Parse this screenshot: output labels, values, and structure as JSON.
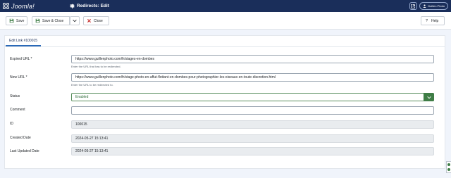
{
  "header": {
    "logo_text": "Joomla!",
    "page_title": "Redirects: Edit",
    "user_button": "Guillen Photo"
  },
  "toolbar": {
    "save_label": "Save",
    "save_close_label": "Save & Close",
    "close_label": "Close",
    "help_label": "Help"
  },
  "tab": {
    "label": "Edit Link #100015"
  },
  "form": {
    "expired_url": {
      "label": "Expired URL *",
      "value": "https://www.guillenphoto.com/fr/stages-en-dombes",
      "hint": "Enter the URL that has to be redirected."
    },
    "new_url": {
      "label": "New URL *",
      "value": "https://www.guillenphoto.com/fr/stage-photo-en-affut-flottant-en-dombes-pour-photographier-les-oiseaux-en-toute-discretion.html",
      "hint": "Enter the URL to be redirected to."
    },
    "status": {
      "label": "Status",
      "value": "Enabled"
    },
    "comment": {
      "label": "Comment",
      "value": ""
    },
    "id": {
      "label": "ID",
      "value": "100015"
    },
    "created_date": {
      "label": "Created Date",
      "value": "2024-05-27 15:13:41"
    },
    "last_updated_date": {
      "label": "Last Updated Date",
      "value": "2024-05-27 15:13:41"
    }
  },
  "colors": {
    "header_bg": "#1a2e5a",
    "status_green": "#3f7d46",
    "cancel_red": "#c52827"
  },
  "icons": [
    "joomla-logo-icon",
    "signpost-icon",
    "external-link-icon",
    "user-icon",
    "save-icon",
    "chevron-down-icon",
    "close-icon",
    "help-icon"
  ]
}
